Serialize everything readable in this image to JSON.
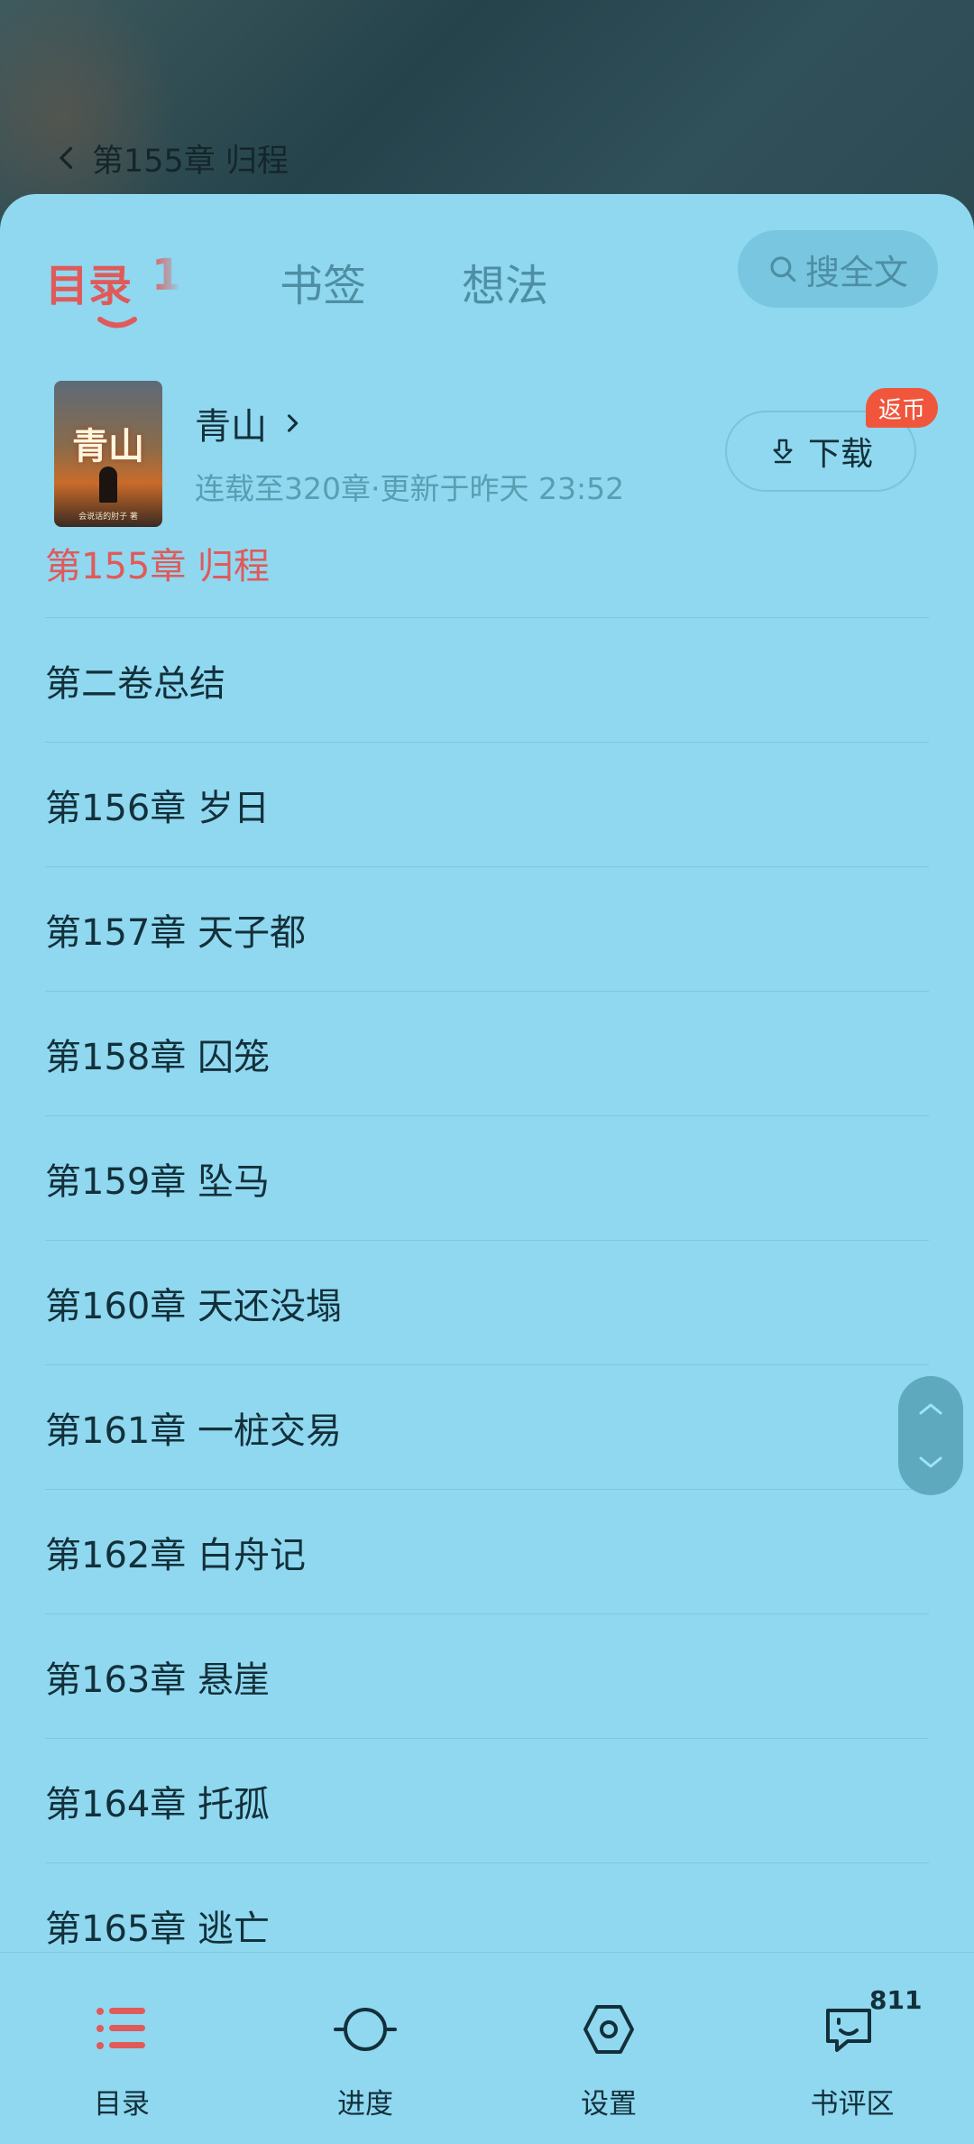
{
  "reader": {
    "current_chapter": "第155章 归程"
  },
  "tabs": [
    {
      "label": "目录",
      "count": "1",
      "active": true
    },
    {
      "label": "书签",
      "active": false
    },
    {
      "label": "想法",
      "active": false
    }
  ],
  "search": {
    "label": "搜全文"
  },
  "book": {
    "title": "青山",
    "cover_title": "青山",
    "cover_author": "会说话的肘子 著",
    "meta": "连载至320章·更新于昨天 23:52",
    "download_label": "下载",
    "coin_badge": "返币"
  },
  "chapters": [
    {
      "title": "第155章 归程",
      "current": true
    },
    {
      "title": "第二卷总结"
    },
    {
      "title": "第156章 岁日"
    },
    {
      "title": "第157章 天子都"
    },
    {
      "title": "第158章 囚笼"
    },
    {
      "title": "第159章 坠马"
    },
    {
      "title": "第160章 天还没塌"
    },
    {
      "title": "第161章 一桩交易"
    },
    {
      "title": "第162章 白舟记"
    },
    {
      "title": "第163章 悬崖"
    },
    {
      "title": "第164章 托孤"
    },
    {
      "title": "第165章 逃亡"
    }
  ],
  "bottom_nav": [
    {
      "label": "目录",
      "icon": "list-icon",
      "active": true
    },
    {
      "label": "进度",
      "icon": "progress-icon"
    },
    {
      "label": "设置",
      "icon": "settings-icon"
    },
    {
      "label": "书评区",
      "icon": "comments-icon",
      "badge": "811"
    }
  ],
  "colors": {
    "sheet_bg": "#8fd8f0",
    "accent_red": "#e05a5a",
    "text_dark": "#13303a",
    "text_muted": "#4e8ea3",
    "badge_orange": "#f0563c"
  }
}
